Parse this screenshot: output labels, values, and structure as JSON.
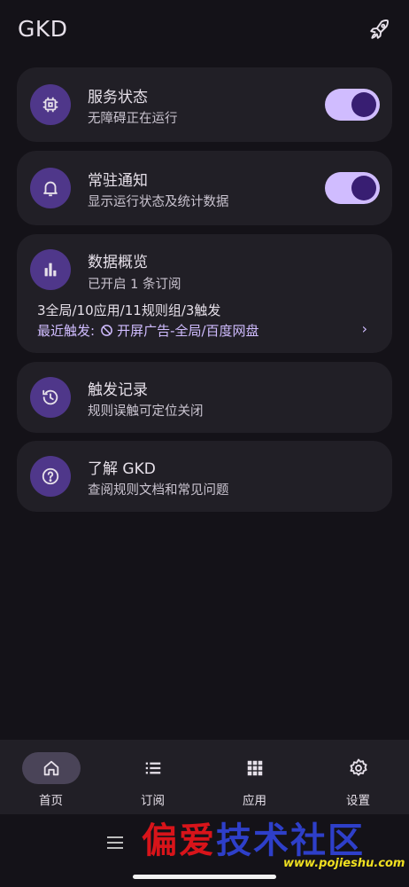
{
  "header": {
    "title": "GKD",
    "action_icon": "rocket-icon"
  },
  "cards": {
    "service": {
      "title": "服务状态",
      "subtitle": "无障碍正在运行",
      "icon": "chip-icon",
      "enabled": true
    },
    "notify": {
      "title": "常驻通知",
      "subtitle": "显示运行状态及统计数据",
      "icon": "bell-icon",
      "enabled": true
    },
    "overview": {
      "title": "数据概览",
      "subtitle": "已开启 1 条订阅",
      "icon": "bar-chart-icon",
      "stats": "3全局/10应用/11规则组/3触发",
      "recent_prefix": "最近触发:",
      "recent_value": "开屏广告-全局/百度网盘",
      "recent_icon": "ban-icon"
    },
    "log": {
      "title": "触发记录",
      "subtitle": "规则误触可定位关闭",
      "icon": "history-icon"
    },
    "about": {
      "title": "了解 GKD",
      "subtitle": "查阅规则文档和常见问题",
      "icon": "help-circle-icon"
    }
  },
  "bottom_nav": {
    "items": [
      {
        "label": "首页",
        "icon": "home-icon",
        "active": true
      },
      {
        "label": "订阅",
        "icon": "list-icon",
        "active": false
      },
      {
        "label": "应用",
        "icon": "grid-icon",
        "active": false
      },
      {
        "label": "设置",
        "icon": "gear-icon",
        "active": false
      }
    ]
  },
  "watermark": {
    "text": "偏爱技术社区",
    "url": "www.pojieshu.com"
  },
  "colors": {
    "background": "#141218",
    "card": "#211f26",
    "accent": "#d0bcff",
    "icon_bg": "#4f378a"
  }
}
